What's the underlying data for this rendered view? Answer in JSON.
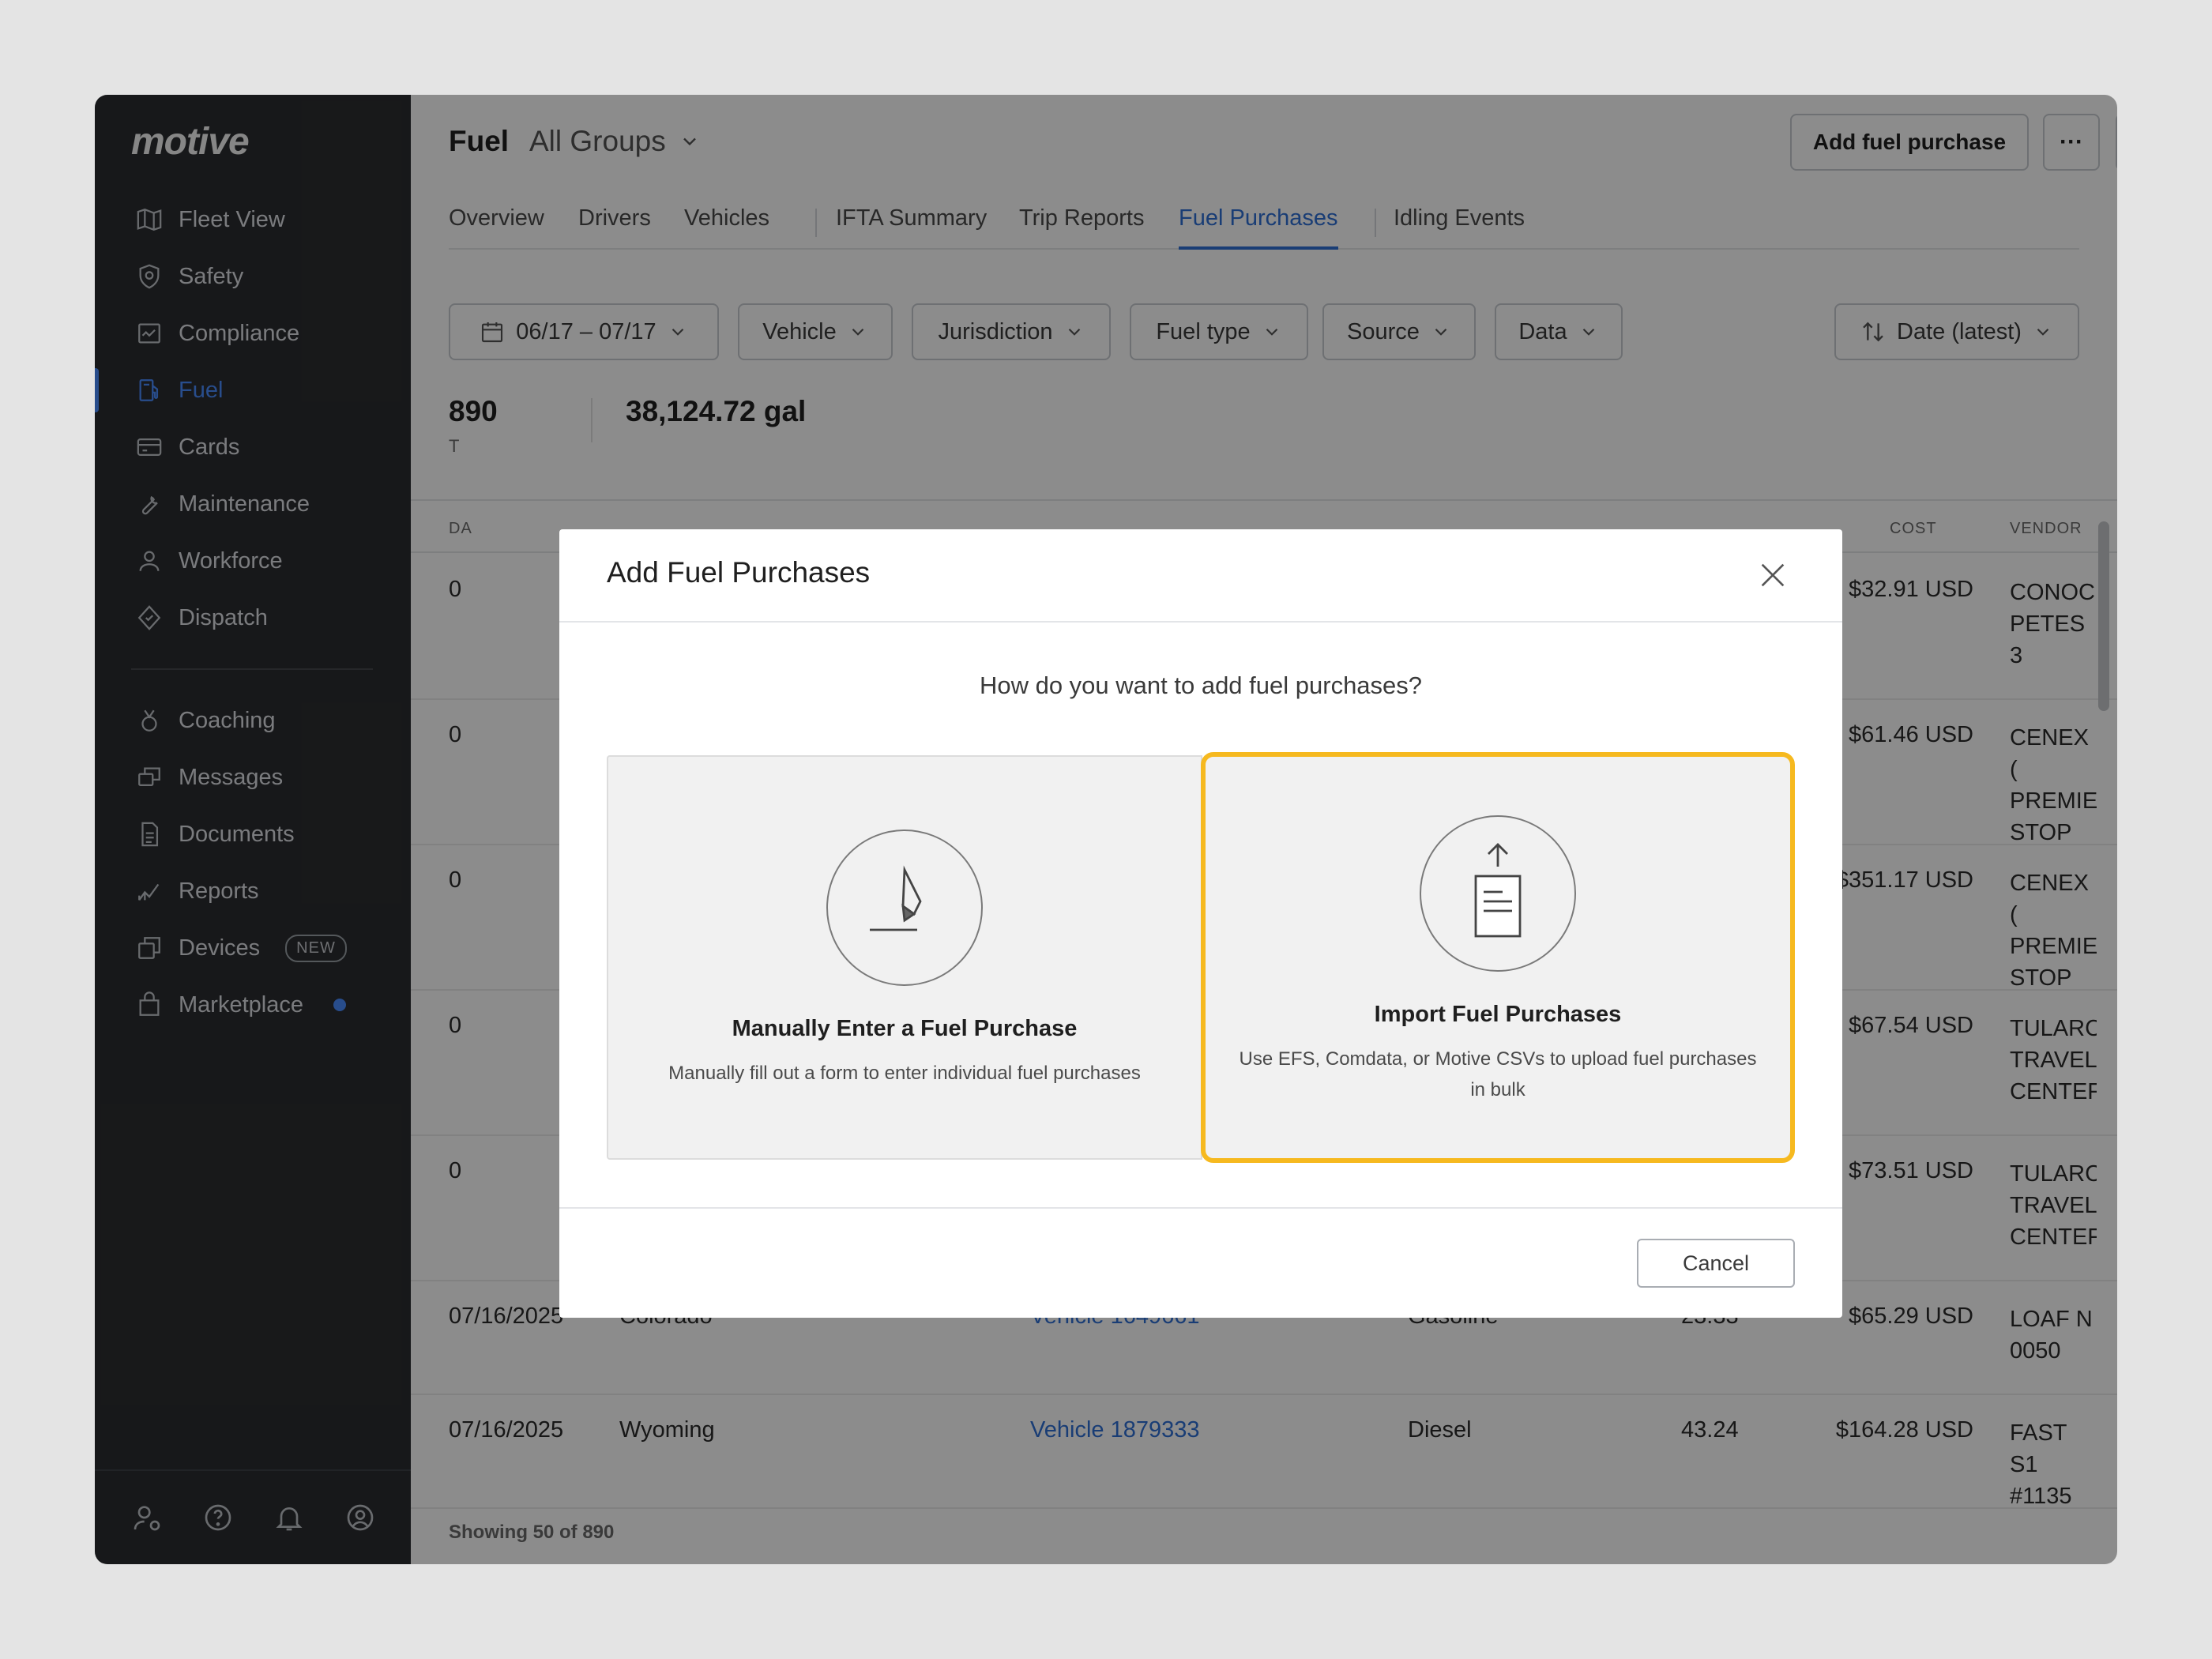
{
  "app": {
    "logo": "motive"
  },
  "sidebar": {
    "items": [
      {
        "label": "Fleet View",
        "icon": "map-icon"
      },
      {
        "label": "Safety",
        "icon": "shield-icon"
      },
      {
        "label": "Compliance",
        "icon": "compliance-icon"
      },
      {
        "label": "Fuel",
        "icon": "fuel-pump-icon",
        "active": true
      },
      {
        "label": "Cards",
        "icon": "card-icon"
      },
      {
        "label": "Maintenance",
        "icon": "wrench-icon"
      },
      {
        "label": "Workforce",
        "icon": "person-icon"
      },
      {
        "label": "Dispatch",
        "icon": "dispatch-icon"
      }
    ],
    "items2": [
      {
        "label": "Coaching",
        "icon": "coaching-icon"
      },
      {
        "label": "Messages",
        "icon": "messages-icon"
      },
      {
        "label": "Documents",
        "icon": "document-icon"
      },
      {
        "label": "Reports",
        "icon": "reports-icon"
      },
      {
        "label": "Devices",
        "icon": "devices-icon",
        "badge": "NEW"
      },
      {
        "label": "Marketplace",
        "icon": "marketplace-icon",
        "dot": true
      }
    ]
  },
  "header": {
    "title": "Fuel",
    "group": "All Groups",
    "add_button": "Add fuel purchase",
    "more_button": "···"
  },
  "tabs": [
    {
      "label": "Overview"
    },
    {
      "label": "Drivers"
    },
    {
      "label": "Vehicles"
    },
    {
      "label": "IFTA Summary"
    },
    {
      "label": "Trip Reports"
    },
    {
      "label": "Fuel Purchases",
      "active": true
    },
    {
      "label": "Idling Events"
    }
  ],
  "filters": {
    "date": "06/17 – 07/17",
    "vehicle": "Vehicle",
    "jurisdiction": "Jurisdiction",
    "fuel_type": "Fuel type",
    "source": "Source",
    "data": "Data",
    "sort": "Date (latest)"
  },
  "stats": {
    "count": "890",
    "count_label_partial": "T",
    "gallons": "38,124.72 gal"
  },
  "table": {
    "headers": {
      "date_partial": "DA",
      "cost": "COST",
      "vendor": "VENDOR"
    },
    "rows": [
      {
        "date": "0",
        "cost": "$32.91 USD",
        "vendor": [
          "CONOC",
          "PETES 3"
        ]
      },
      {
        "date": "0",
        "cost": "$61.46 USD",
        "vendor": [
          "CENEX (",
          "PREMIEI",
          "STOP"
        ]
      },
      {
        "date": "0",
        "cost": "$351.17 USD",
        "vendor": [
          "CENEX (",
          "PREMIEI",
          "STOP"
        ]
      },
      {
        "date": "0",
        "cost": "$67.54 USD",
        "vendor": [
          "TULARC",
          "TRAVEL",
          "CENTEF"
        ]
      },
      {
        "date": "0",
        "cost": "$73.51 USD",
        "vendor": [
          "TULARC",
          "TRAVEL",
          "CENTEF"
        ]
      },
      {
        "date": "07/16/2025",
        "jurisdiction": "Colorado",
        "vehicle": "Vehicle 1649661",
        "fuel": "Gasoline",
        "gallons": "23.33",
        "cost": "$65.29 USD",
        "vendor": [
          "LOAF N",
          "0050"
        ]
      },
      {
        "date": "07/16/2025",
        "jurisdiction": "Wyoming",
        "vehicle": "Vehicle 1879333",
        "fuel": "Diesel",
        "gallons": "43.24",
        "cost": "$164.28 USD",
        "vendor": [
          "FAST S1",
          "#1135"
        ]
      }
    ],
    "footer": "Showing 50 of 890"
  },
  "modal": {
    "title": "Add Fuel Purchases",
    "question": "How do you want to add fuel purchases?",
    "option_manual": {
      "title": "Manually Enter a Fuel Purchase",
      "desc": "Manually fill out a form to enter individual fuel purchases"
    },
    "option_import": {
      "title": "Import Fuel Purchases",
      "desc": "Use EFS, Comdata, or Motive CSVs to upload fuel purchases in bulk"
    },
    "cancel": "Cancel"
  },
  "colors": {
    "accent": "#2f6fd6",
    "highlight": "#f6b91f",
    "sidebar": "#2b2d30"
  }
}
